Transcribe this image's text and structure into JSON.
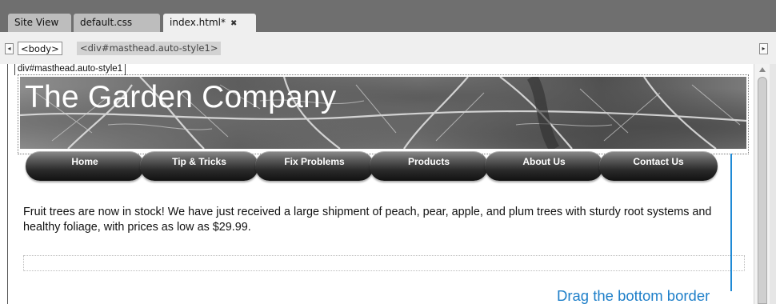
{
  "tabs": [
    {
      "label": "Site View",
      "close": ""
    },
    {
      "label": "default.css",
      "close": ""
    },
    {
      "label": "index.html*",
      "close": "✖"
    }
  ],
  "tag_selector": {
    "back": "◂",
    "forward": "▸",
    "body_tag": "<body>",
    "current_tag": "<div#masthead.auto-style1>"
  },
  "design": {
    "div_label": "div#masthead.auto-style1",
    "brand": "The Garden Company",
    "nav": [
      "Home",
      "Tip & Tricks",
      "Fix Problems",
      "Products",
      "About Us",
      "Contact Us"
    ],
    "body_text": "Fruit trees are now in stock! We have just received a large shipment of peach, pear, apple, and plum trees with sturdy root systems and healthy foliage, with prices as low as $29.99."
  },
  "callout": "Drag the bottom border",
  "colors": {
    "callout": "#1e7fc9",
    "tabstrip": "#6f6f6f",
    "active_tab": "#efefef"
  }
}
